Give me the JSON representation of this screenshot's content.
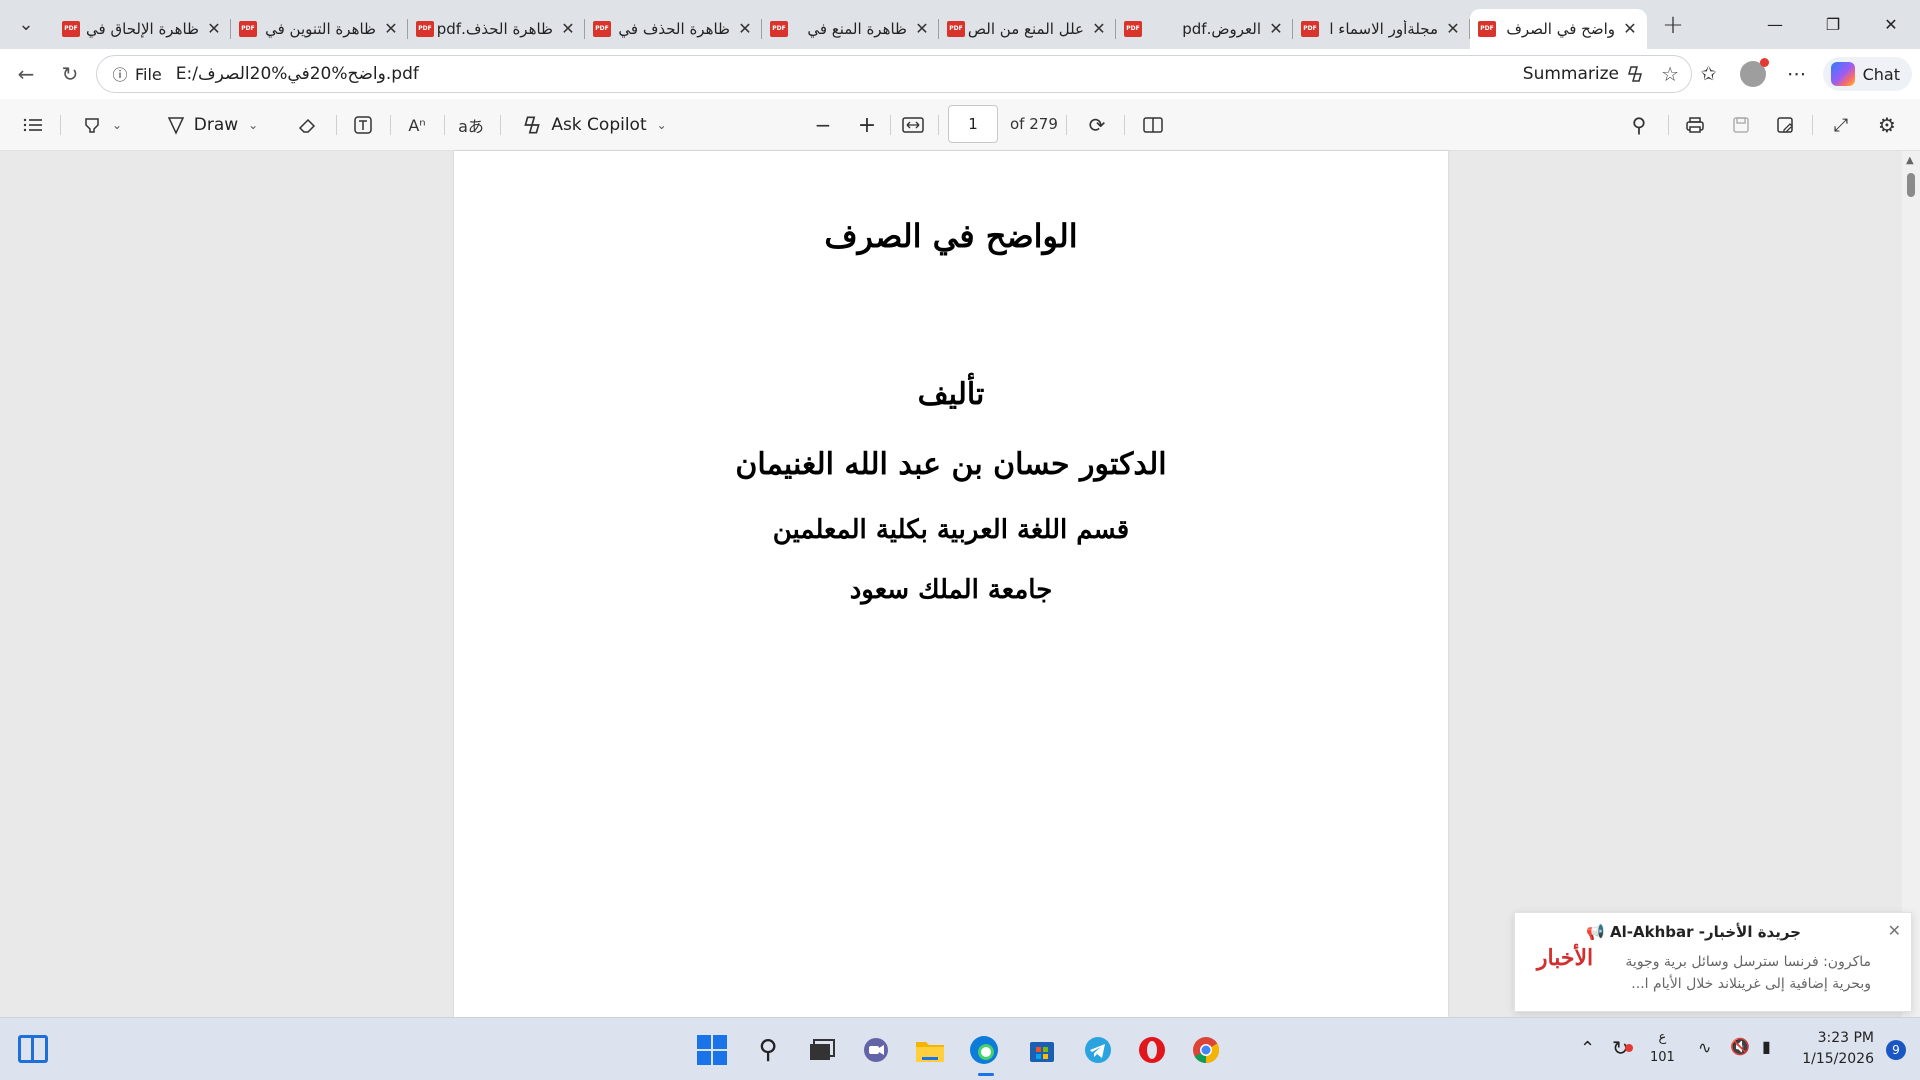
{
  "browser": {
    "tabs": [
      {
        "title": "ظاهرة الإلحاق في",
        "active": false
      },
      {
        "title": "ظاهرة التنوين في",
        "active": false
      },
      {
        "title": "ظاهرة الحذف.pdf",
        "active": false
      },
      {
        "title": "ظاهرة الحذف في",
        "active": false
      },
      {
        "title": "ظاهرة المنع في",
        "active": false
      },
      {
        "title": "علل المنع من الص",
        "active": false
      },
      {
        "title": "العروض.pdf",
        "active": false
      },
      {
        "title": "مجلةأور الاسماء ا",
        "active": false
      },
      {
        "title": "واضح في الصرف",
        "active": true
      }
    ],
    "pdf_icon_label": "PDF",
    "address": {
      "scheme": "File",
      "url": "E:/واضح%20في%20الصرف.pdf",
      "summarize_label": "Summarize"
    },
    "chat_label": "Chat"
  },
  "pdf_toolbar": {
    "draw_label": "Draw",
    "ask_copilot_label": "Ask Copilot",
    "page_number": "1",
    "page_total": "of 279"
  },
  "document": {
    "title": "الواضح في الصرف",
    "authorship": "تأليف",
    "author": "الدكتور حسان بن عبد الله الغنيمان",
    "department": "قسم اللغة العربية بكلية المعلمين",
    "university": "جامعة الملك سعود"
  },
  "notification": {
    "title": "جريدة الأخبار- Al-Akhbar 📢",
    "body": "ماكرون: فرنسا سترسل وسائل برية وجوية وبحرية إضافية إلى غرينلاند خلال الأيام ا...",
    "logo_text": "الأخبار"
  },
  "taskbar": {
    "weather_glyph": "ع",
    "weather_value": "101",
    "time": "3:23 PM",
    "date": "1/15/2026",
    "notification_count": "9"
  }
}
